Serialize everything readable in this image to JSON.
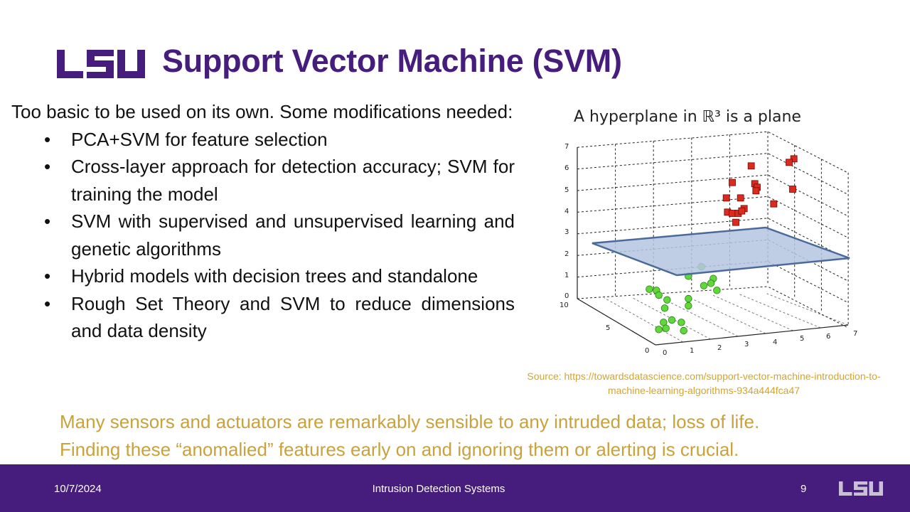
{
  "logo_text": "LSU",
  "title": "Support Vector Machine (SVM)",
  "intro": "Too basic to be used on its own. Some modifications needed:",
  "bullets": [
    "PCA+SVM for feature selection",
    "Cross-layer approach for detection accuracy; SVM for training the model",
    "SVM with supervised and unsupervised learning and genetic algorithms",
    "Hybrid models with decision trees and standalone",
    "Rough Set Theory and SVM to reduce dimensions and data density"
  ],
  "figure": {
    "title": "A hyperplane in ℝ³ is a plane",
    "z_ticks": [
      "0",
      "1",
      "2",
      "3",
      "4",
      "5",
      "6",
      "7"
    ],
    "y_ticks": [
      "10",
      "5",
      "0"
    ],
    "x_ticks": [
      "0",
      "1",
      "2",
      "3",
      "4",
      "5",
      "6",
      "7"
    ],
    "colors": {
      "class_a": "#dd2a1e",
      "class_b": "#5fd93a",
      "plane": "#b5c6e0",
      "plane_edge": "#4a6a9a"
    }
  },
  "source": "Source: https://towardsdatascience.com/support-vector-machine-introduction-to-machine-learning-algorithms-934a444fca47",
  "note_lines": [
    "Many sensors and actuators are remarkably sensible to any intruded data; loss of life.",
    "Finding these “anomalied” features early on and ignoring them or alerting is crucial."
  ],
  "footer": {
    "date": "10/7/2024",
    "center": "Intrusion Detection Systems",
    "page": "9",
    "logo_text": "LSU"
  },
  "colors": {
    "brand_purple": "#461d7c",
    "accent_gold": "#c9a23c"
  }
}
